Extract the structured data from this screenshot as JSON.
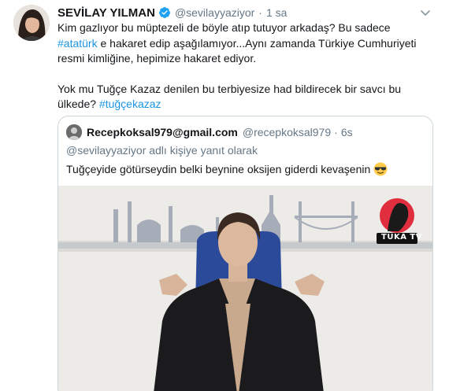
{
  "tweet": {
    "author_name": "SEVİLAY YILMAN",
    "handle": "@sevilayyaziyor",
    "separator": "·",
    "time": "1 sa",
    "text_line1_a": "Kim gazlıyor bu müptezeli de böyle atıp tutuyor arkadaş? Bu sadece ",
    "hashtag1": "#atatürk",
    "text_line2": " e hakaret edip aşağılamıyor...Aynı zamanda Türkiye Cumhuriyeti resmi kimliğine, hepimize hakaret ediyor.",
    "text_para2": "Yok mu Tuğçe Kazaz denilen bu terbiyesize had bildirecek bir savcı bu ülkede? ",
    "hashtag2": "#tuğçekazaz"
  },
  "quote": {
    "author_name": "Recepkoksal979@gmail.com",
    "handle": "@recepkoksal979",
    "separator": "·",
    "time": "6s",
    "reply_context": "@sevilayyaziyor adlı kişiye yanıt olarak",
    "text": "Tuğçeyide götürseydin belki beynine oksijen giderdi kevaşenin",
    "emoji": "sunglasses-emoji"
  },
  "media": {
    "watermark_text": "TUKA TV",
    "watermark_color": "#e0192b"
  },
  "colors": {
    "link": "#1b95e0",
    "secondary": "#657786",
    "verified": "#1da1f2"
  }
}
